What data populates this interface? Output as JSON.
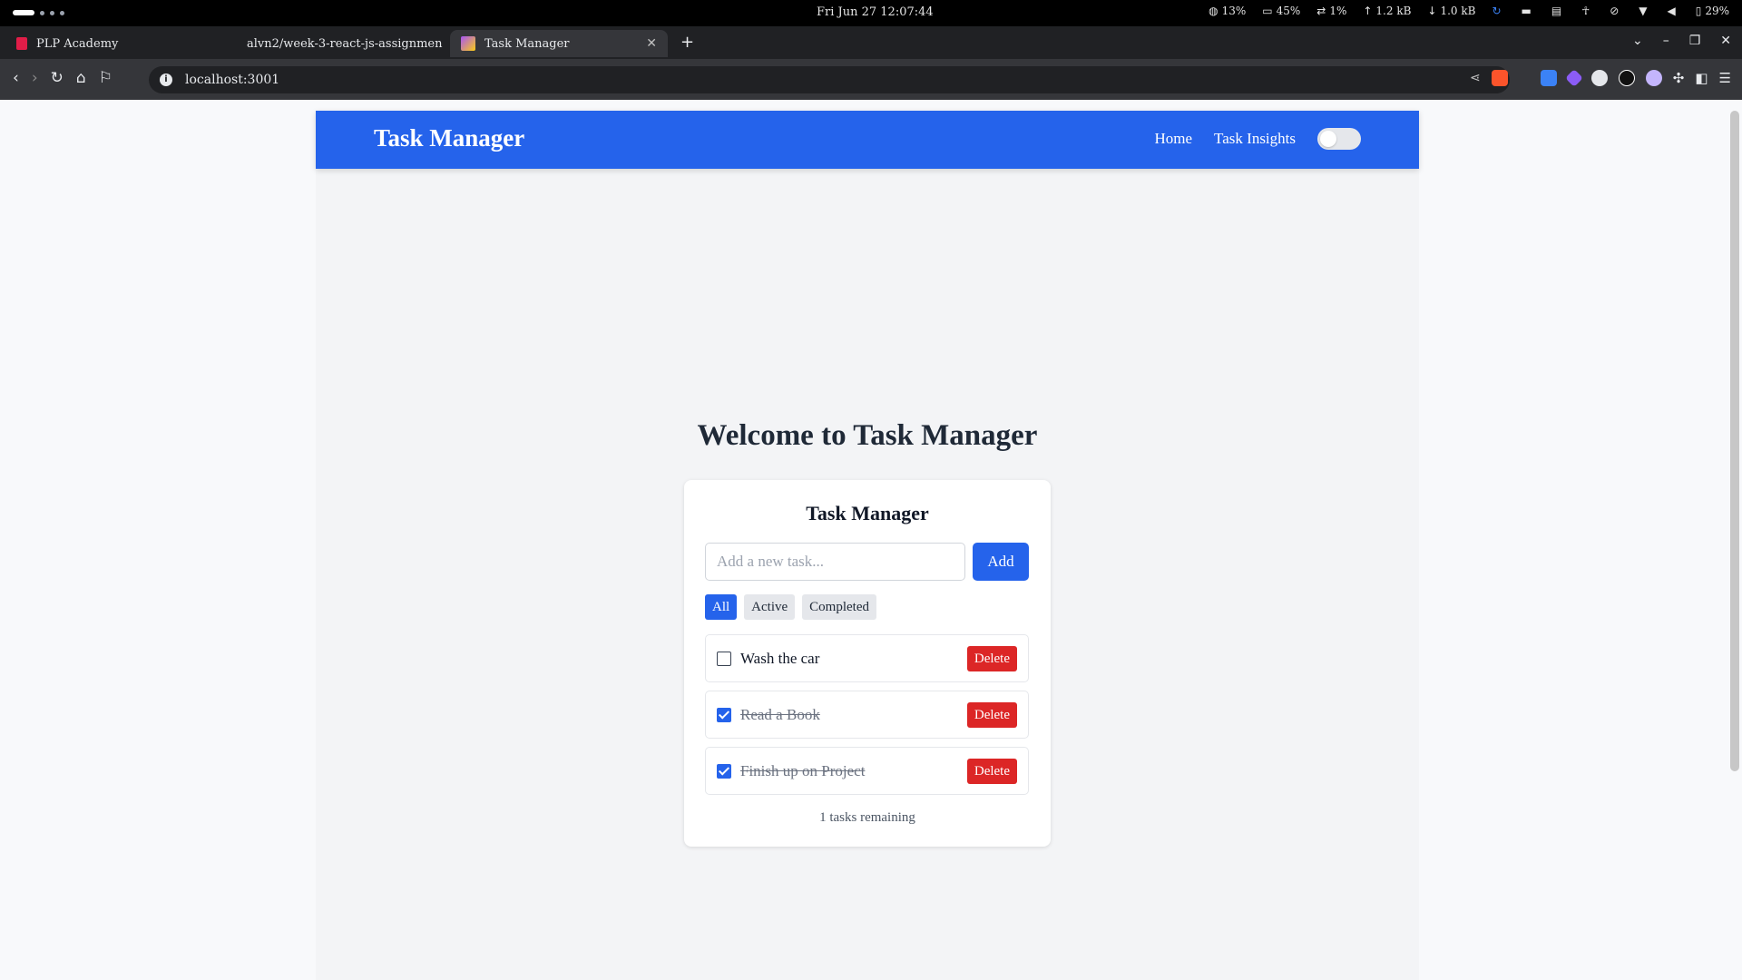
{
  "os": {
    "clock": "Fri Jun 27  12:07:44",
    "stats": {
      "cpu": "13%",
      "mem": "45%",
      "swap": "1%",
      "up": "1.2 kB",
      "down": "1.0 kB",
      "battery": "29%"
    }
  },
  "browser": {
    "tabs": [
      {
        "title": "PLP Academy",
        "favicon": "plp-logo-icon",
        "color": "#e11d48"
      },
      {
        "title": "alvn2/week-3-react-js-assignmen",
        "favicon": "github-icon",
        "color": "#ffffff"
      },
      {
        "title": "Task Manager",
        "favicon": "vite-icon",
        "color": "#a855f7"
      }
    ],
    "url": "localhost:3001"
  },
  "app": {
    "brand": "Task Manager",
    "nav": {
      "home": "Home",
      "insights": "Task Insights"
    },
    "theme_toggle_on": false,
    "welcome": "Welcome to Task Manager",
    "card": {
      "title": "Task Manager",
      "input_placeholder": "Add a new task...",
      "input_value": "",
      "add_label": "Add",
      "filters": [
        "All",
        "Active",
        "Completed"
      ],
      "active_filter": "All",
      "tasks": [
        {
          "text": "Wash the car",
          "completed": false,
          "delete_label": "Delete"
        },
        {
          "text": "Read a Book",
          "completed": true,
          "delete_label": "Delete"
        },
        {
          "text": "Finish up on Project",
          "completed": true,
          "delete_label": "Delete"
        }
      ],
      "remaining": "1 tasks remaining"
    }
  },
  "colors": {
    "primary": "#2563eb",
    "danger": "#dc2626",
    "page_bg": "#f3f4f6"
  }
}
